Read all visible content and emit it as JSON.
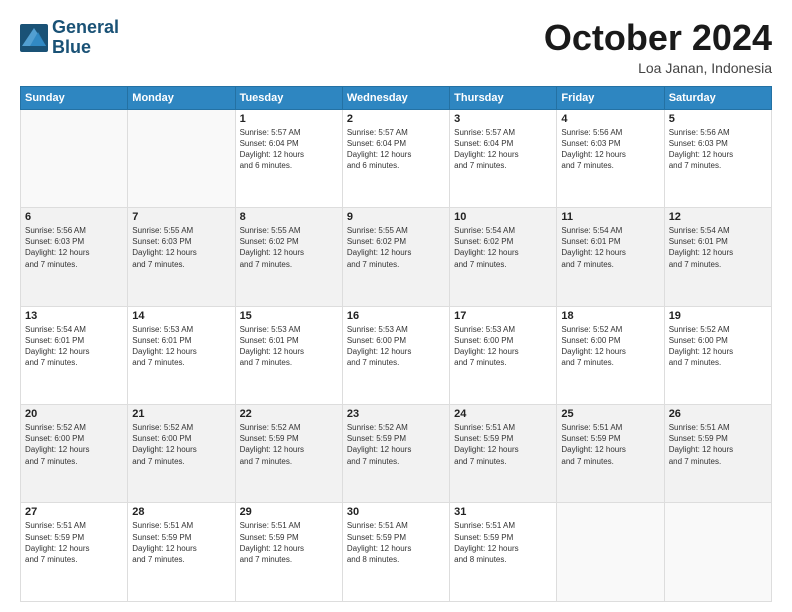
{
  "header": {
    "logo_line1": "General",
    "logo_line2": "Blue",
    "title": "October 2024",
    "location": "Loa Janan, Indonesia"
  },
  "days_of_week": [
    "Sunday",
    "Monday",
    "Tuesday",
    "Wednesday",
    "Thursday",
    "Friday",
    "Saturday"
  ],
  "weeks": [
    [
      {
        "day": "",
        "info": ""
      },
      {
        "day": "",
        "info": ""
      },
      {
        "day": "1",
        "info": "Sunrise: 5:57 AM\nSunset: 6:04 PM\nDaylight: 12 hours\nand 6 minutes."
      },
      {
        "day": "2",
        "info": "Sunrise: 5:57 AM\nSunset: 6:04 PM\nDaylight: 12 hours\nand 6 minutes."
      },
      {
        "day": "3",
        "info": "Sunrise: 5:57 AM\nSunset: 6:04 PM\nDaylight: 12 hours\nand 7 minutes."
      },
      {
        "day": "4",
        "info": "Sunrise: 5:56 AM\nSunset: 6:03 PM\nDaylight: 12 hours\nand 7 minutes."
      },
      {
        "day": "5",
        "info": "Sunrise: 5:56 AM\nSunset: 6:03 PM\nDaylight: 12 hours\nand 7 minutes."
      }
    ],
    [
      {
        "day": "6",
        "info": "Sunrise: 5:56 AM\nSunset: 6:03 PM\nDaylight: 12 hours\nand 7 minutes."
      },
      {
        "day": "7",
        "info": "Sunrise: 5:55 AM\nSunset: 6:03 PM\nDaylight: 12 hours\nand 7 minutes."
      },
      {
        "day": "8",
        "info": "Sunrise: 5:55 AM\nSunset: 6:02 PM\nDaylight: 12 hours\nand 7 minutes."
      },
      {
        "day": "9",
        "info": "Sunrise: 5:55 AM\nSunset: 6:02 PM\nDaylight: 12 hours\nand 7 minutes."
      },
      {
        "day": "10",
        "info": "Sunrise: 5:54 AM\nSunset: 6:02 PM\nDaylight: 12 hours\nand 7 minutes."
      },
      {
        "day": "11",
        "info": "Sunrise: 5:54 AM\nSunset: 6:01 PM\nDaylight: 12 hours\nand 7 minutes."
      },
      {
        "day": "12",
        "info": "Sunrise: 5:54 AM\nSunset: 6:01 PM\nDaylight: 12 hours\nand 7 minutes."
      }
    ],
    [
      {
        "day": "13",
        "info": "Sunrise: 5:54 AM\nSunset: 6:01 PM\nDaylight: 12 hours\nand 7 minutes."
      },
      {
        "day": "14",
        "info": "Sunrise: 5:53 AM\nSunset: 6:01 PM\nDaylight: 12 hours\nand 7 minutes."
      },
      {
        "day": "15",
        "info": "Sunrise: 5:53 AM\nSunset: 6:01 PM\nDaylight: 12 hours\nand 7 minutes."
      },
      {
        "day": "16",
        "info": "Sunrise: 5:53 AM\nSunset: 6:00 PM\nDaylight: 12 hours\nand 7 minutes."
      },
      {
        "day": "17",
        "info": "Sunrise: 5:53 AM\nSunset: 6:00 PM\nDaylight: 12 hours\nand 7 minutes."
      },
      {
        "day": "18",
        "info": "Sunrise: 5:52 AM\nSunset: 6:00 PM\nDaylight: 12 hours\nand 7 minutes."
      },
      {
        "day": "19",
        "info": "Sunrise: 5:52 AM\nSunset: 6:00 PM\nDaylight: 12 hours\nand 7 minutes."
      }
    ],
    [
      {
        "day": "20",
        "info": "Sunrise: 5:52 AM\nSunset: 6:00 PM\nDaylight: 12 hours\nand 7 minutes."
      },
      {
        "day": "21",
        "info": "Sunrise: 5:52 AM\nSunset: 6:00 PM\nDaylight: 12 hours\nand 7 minutes."
      },
      {
        "day": "22",
        "info": "Sunrise: 5:52 AM\nSunset: 5:59 PM\nDaylight: 12 hours\nand 7 minutes."
      },
      {
        "day": "23",
        "info": "Sunrise: 5:52 AM\nSunset: 5:59 PM\nDaylight: 12 hours\nand 7 minutes."
      },
      {
        "day": "24",
        "info": "Sunrise: 5:51 AM\nSunset: 5:59 PM\nDaylight: 12 hours\nand 7 minutes."
      },
      {
        "day": "25",
        "info": "Sunrise: 5:51 AM\nSunset: 5:59 PM\nDaylight: 12 hours\nand 7 minutes."
      },
      {
        "day": "26",
        "info": "Sunrise: 5:51 AM\nSunset: 5:59 PM\nDaylight: 12 hours\nand 7 minutes."
      }
    ],
    [
      {
        "day": "27",
        "info": "Sunrise: 5:51 AM\nSunset: 5:59 PM\nDaylight: 12 hours\nand 7 minutes."
      },
      {
        "day": "28",
        "info": "Sunrise: 5:51 AM\nSunset: 5:59 PM\nDaylight: 12 hours\nand 7 minutes."
      },
      {
        "day": "29",
        "info": "Sunrise: 5:51 AM\nSunset: 5:59 PM\nDaylight: 12 hours\nand 7 minutes."
      },
      {
        "day": "30",
        "info": "Sunrise: 5:51 AM\nSunset: 5:59 PM\nDaylight: 12 hours\nand 8 minutes."
      },
      {
        "day": "31",
        "info": "Sunrise: 5:51 AM\nSunset: 5:59 PM\nDaylight: 12 hours\nand 8 minutes."
      },
      {
        "day": "",
        "info": ""
      },
      {
        "day": "",
        "info": ""
      }
    ]
  ]
}
